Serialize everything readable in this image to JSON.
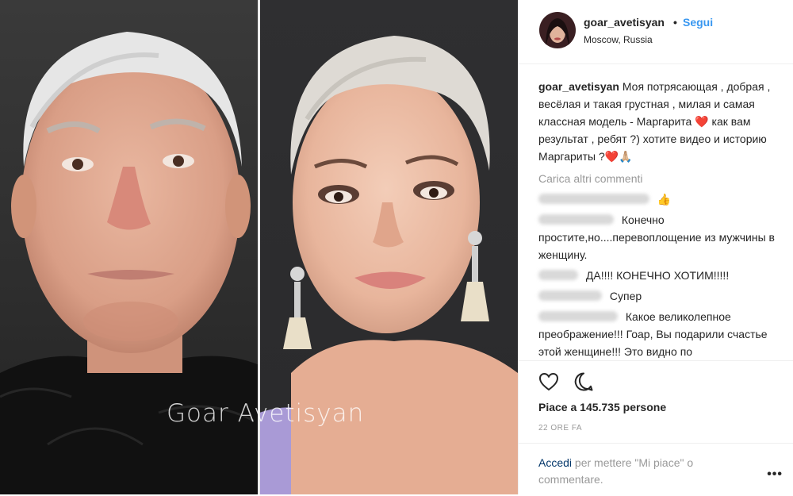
{
  "photo": {
    "watermark": "Goar Avetisyan"
  },
  "header": {
    "username": "goar_avetisyan",
    "separator": "•",
    "follow_label": "Segui",
    "location": "Moscow, Russia"
  },
  "caption": {
    "username": "goar_avetisyan",
    "text": "Моя потрясающая , добрая , весёлая и такая грустная , милая и самая классная модель - Маргарита ❤️ как вам результат , ребят ?) хотите видео и историю Маргариты ?❤️🙏🏼"
  },
  "load_more_label": "Carica altri commenti",
  "comments": [
    {
      "text": "👍"
    },
    {
      "text": "Конечно простите,но....перевоплощение из мужчины в женщину."
    },
    {
      "text": "ДА!!!! КОНЕЧНО ХОТИМ!!!!!"
    },
    {
      "text": "Супер"
    },
    {
      "text": "Какое великолепное преображение!!! Гоар, Вы подарили счастье этой женщине!!! Это видно по"
    }
  ],
  "likes_label": "Piace a 145.735 persone",
  "time_label": "22 ORE FA",
  "login": {
    "link": "Accedi",
    "rest": " per mettere \"Mi piace\" o commentare."
  },
  "more_label": "•••",
  "icons": {
    "like": "heart-icon",
    "comment": "comment-bubble-icon",
    "more": "more-options-icon"
  },
  "colors": {
    "link": "#3897f0",
    "text": "#262626",
    "muted": "#999999"
  }
}
